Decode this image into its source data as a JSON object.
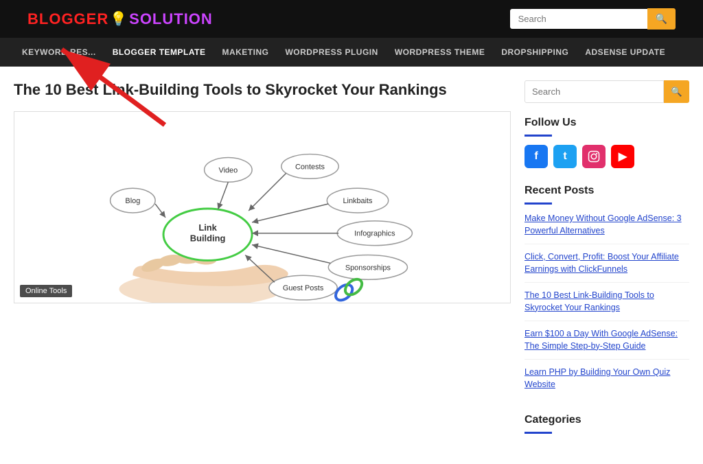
{
  "header": {
    "logo_blogger": "BLOGGER",
    "logo_icon": "💡",
    "logo_solution": "SOLUTION",
    "search_placeholder": "Search"
  },
  "nav": {
    "items": [
      {
        "label": "KEYWORD RES...",
        "id": "keyword-research"
      },
      {
        "label": "BLOGGER TEMPLATE",
        "id": "blogger-template",
        "active": true
      },
      {
        "label": "MAKETING",
        "id": "maketing"
      },
      {
        "label": "WORDPRESS PLUGIN",
        "id": "wordpress-plugin"
      },
      {
        "label": "WORDPRESS THEME",
        "id": "wordpress-theme"
      },
      {
        "label": "DROPSHIPPING",
        "id": "dropshipping"
      },
      {
        "label": "ADSENSE UPDATE",
        "id": "adsense-update"
      }
    ]
  },
  "article": {
    "title": "The 10 Best Link-Building Tools to Skyrocket Your Rankings",
    "image_tag": "Online Tools",
    "diagram": {
      "center": "Link Building",
      "nodes": [
        "Blog",
        "Video",
        "Contests",
        "Linkbaits",
        "Infographics",
        "Sponsorships",
        "Guest Posts"
      ]
    }
  },
  "sidebar": {
    "search_placeholder": "Search",
    "follow_title": "Follow Us",
    "recent_posts_title": "Recent Posts",
    "categories_title": "Categories",
    "recent_posts": [
      {
        "text": "Make Money Without Google AdSense: 3 Powerful Alternatives"
      },
      {
        "text": "Click, Convert, Profit: Boost Your Affiliate Earnings with ClickFunnels"
      },
      {
        "text": "The 10 Best Link-Building Tools to Skyrocket Your Rankings"
      },
      {
        "text": "Earn $100 a Day With Google AdSense: The Simple Step-by-Step Guide"
      },
      {
        "text": "Learn PHP by Building Your Own Quiz Website"
      }
    ],
    "social": {
      "facebook": "f",
      "twitter": "t",
      "instagram": "in",
      "youtube": "▶"
    }
  }
}
